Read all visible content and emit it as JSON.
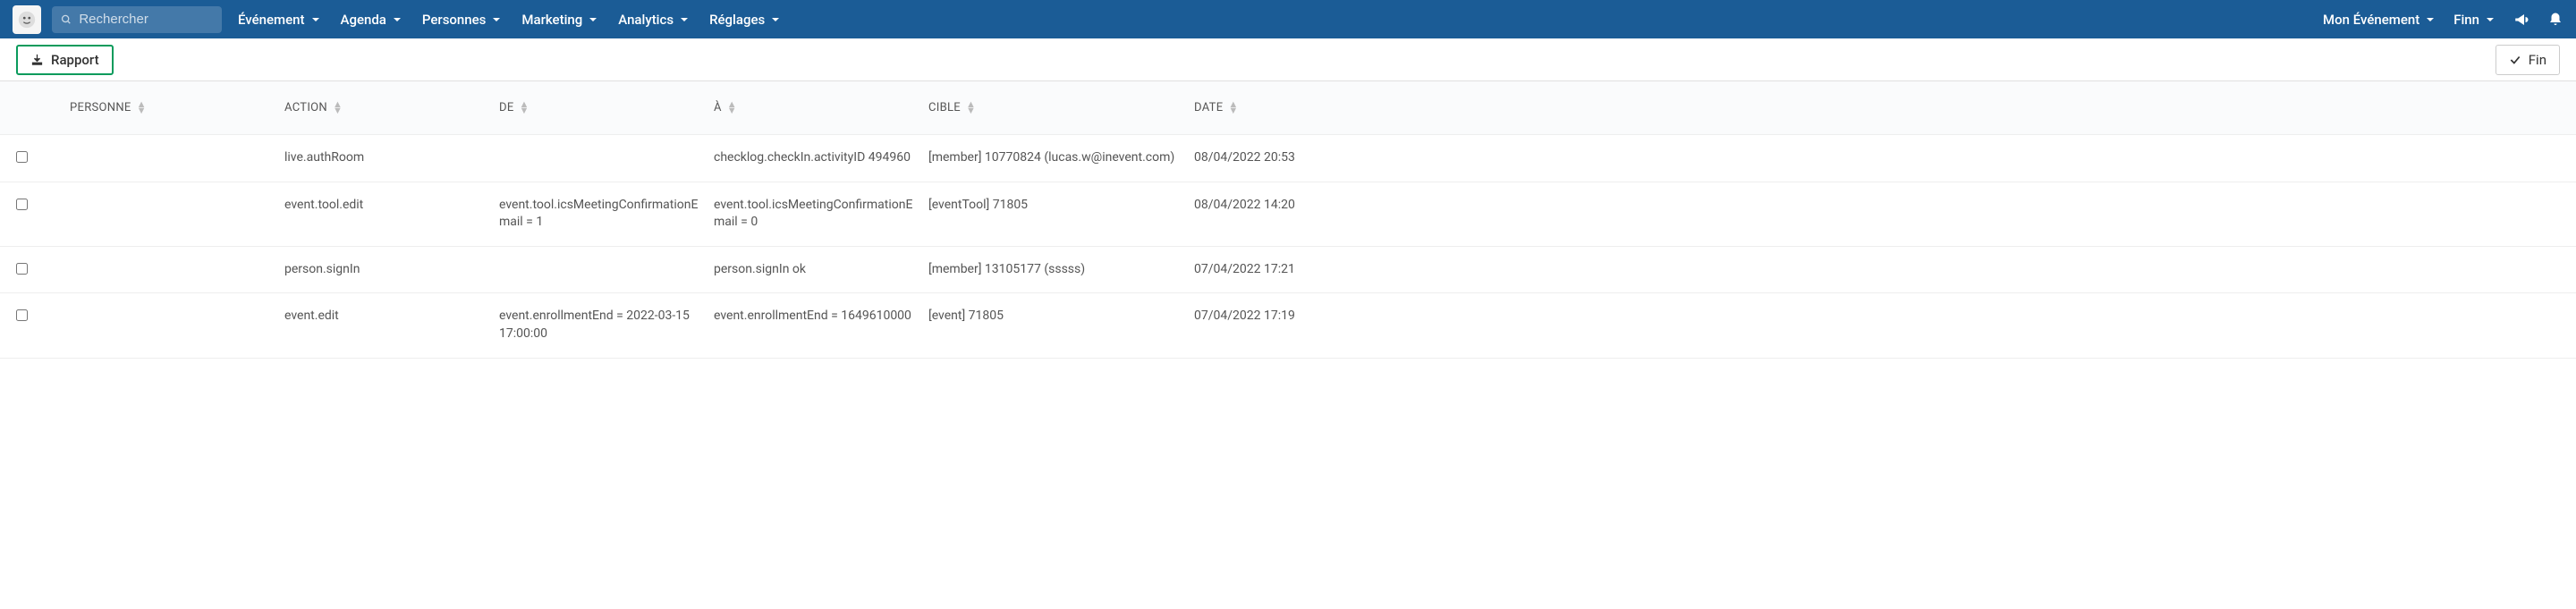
{
  "nav": {
    "search_placeholder": "Rechercher",
    "items": [
      "Événement",
      "Agenda",
      "Personnes",
      "Marketing",
      "Analytics",
      "Réglages"
    ],
    "event_label": "Mon Événement",
    "user_label": "Finn"
  },
  "toolbar": {
    "rapport": "Rapport",
    "fin": "Fin"
  },
  "headers": {
    "personne": "PERSONNE",
    "action": "ACTION",
    "de": "DE",
    "a": "À",
    "cible": "CIBLE",
    "date": "DATE"
  },
  "rows": [
    {
      "personne": "",
      "action": "live.authRoom",
      "de": "",
      "a": "checklog.checkIn.activityID 494960",
      "cible": "[member] 10770824 (lucas.w@inevent.com)",
      "date": "08/04/2022 20:53"
    },
    {
      "personne": "",
      "action": "event.tool.edit",
      "de": "event.tool.icsMeetingConfirmationEmail = 1",
      "a": "event.tool.icsMeetingConfirmationEmail = 0",
      "cible": "[eventTool] 71805",
      "date": "08/04/2022 14:20"
    },
    {
      "personne": "",
      "action": "person.signIn",
      "de": "",
      "a": "person.signIn ok",
      "cible": "[member] 13105177 (sssss)",
      "date": "07/04/2022 17:21"
    },
    {
      "personne": "",
      "action": "event.edit",
      "de": "event.enrollmentEnd = 2022-03-15 17:00:00",
      "a": "event.enrollmentEnd = 1649610000",
      "cible": "[event] 71805",
      "date": "07/04/2022 17:19"
    }
  ]
}
